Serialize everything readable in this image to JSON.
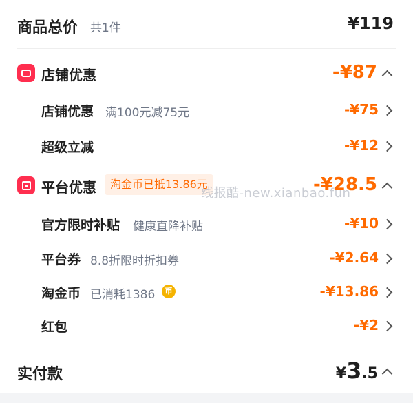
{
  "summary": {
    "title": "商品总价",
    "count": "共1件",
    "price": "¥119"
  },
  "store_discount": {
    "title": "店铺优惠",
    "amount": "-¥87",
    "icon": "store-icon",
    "items": [
      {
        "label": "店铺优惠",
        "note": "满100元减75元",
        "amount": "-¥75"
      },
      {
        "label": "超级立减",
        "note": "",
        "amount": "-¥12"
      }
    ]
  },
  "platform_discount": {
    "title": "平台优惠",
    "tag": "淘金币已抵13.86元",
    "amount": "-¥28.5",
    "icon": "platform-icon",
    "items": [
      {
        "label": "官方限时补贴",
        "note": "健康直降补贴",
        "amount": "-¥10"
      },
      {
        "label": "平台券",
        "note": "8.8折限时折扣券",
        "amount": "-¥2.64"
      },
      {
        "label": "淘金币",
        "note": "已消耗1386",
        "coin_glyph": "币",
        "amount": "-¥13.86"
      },
      {
        "label": "红包",
        "note": "",
        "amount": "-¥2"
      }
    ]
  },
  "watermark": "线报酷-new.xianbao.fun",
  "total": {
    "label": "实付款",
    "currency": "¥",
    "int": "3",
    "dec": ".5"
  },
  "colors": {
    "accent": "#ff6a00",
    "badge": "#ff2e4f",
    "text": "#1f1f1f",
    "muted": "#6f7787"
  }
}
